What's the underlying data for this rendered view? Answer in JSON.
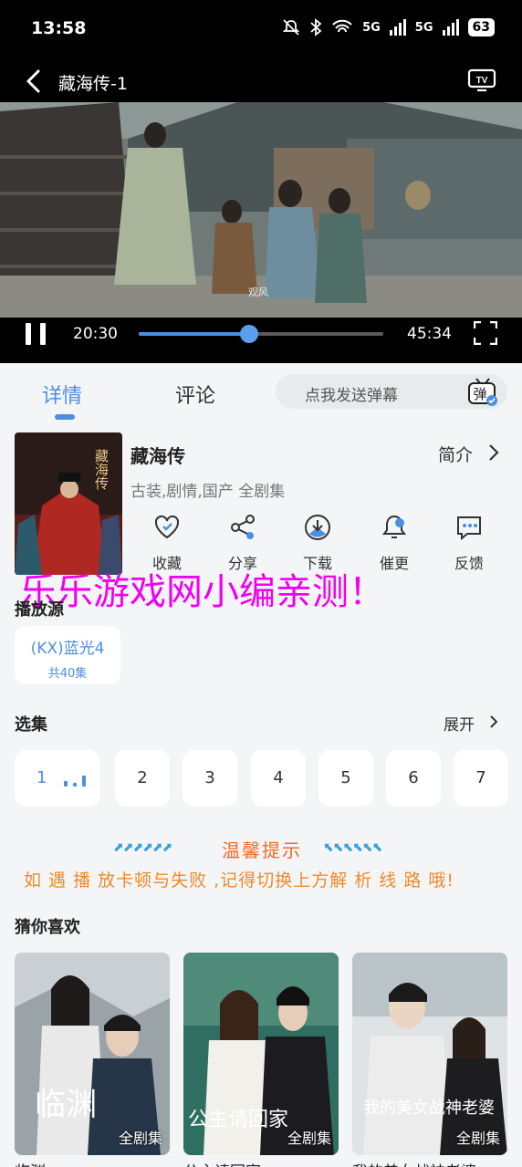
{
  "status_bar": {
    "time": "13:58",
    "signal_1": "5G",
    "signal_2": "5G",
    "battery": "63"
  },
  "nav": {
    "title": "藏海传-1"
  },
  "player": {
    "subtitle": "观风",
    "current_time": "20:30",
    "total_time": "45:34",
    "progress_fraction": 0.45
  },
  "tabs": {
    "detail": "详情",
    "comment": "评论"
  },
  "danmu": {
    "placeholder": "点我发送弹幕",
    "icon_char": "弹"
  },
  "show": {
    "title": "藏海传",
    "intro_label": "简介",
    "tags": "古装,剧情,国产 全剧集",
    "poster_text": "藏海传"
  },
  "actions": [
    {
      "label": "收藏",
      "icon": "heart-icon"
    },
    {
      "label": "分享",
      "icon": "share-icon"
    },
    {
      "label": "下载",
      "icon": "download-icon"
    },
    {
      "label": "催更",
      "icon": "bell-icon"
    },
    {
      "label": "反馈",
      "icon": "feedback-icon"
    }
  ],
  "watermark": "乐乐游戏网小编亲测！",
  "source": {
    "section_title": "播放源",
    "name": "(KX)蓝光4",
    "count": "共40集"
  },
  "episodes": {
    "section_title": "选集",
    "expand_label": "展开",
    "items": [
      "1",
      "2",
      "3",
      "4",
      "5",
      "6",
      "7"
    ]
  },
  "tip": {
    "title": "温馨提示",
    "text": "如 遇 播 放卡顿与失败 ,记得切换上方解 析 线 路 哦!",
    "arrows_left": "⬈⬈⬈⬈⬈⬈",
    "arrows_right": "⬉⬉⬉⬉⬉⬉"
  },
  "recommend": {
    "section_title": "猜你喜欢",
    "items": [
      {
        "title": "临渊",
        "badge": "全剧集",
        "poster_text": "临渊"
      },
      {
        "title": "公主请回家",
        "badge": "全剧集",
        "poster_text": "公主请回家"
      },
      {
        "title": "我的美女战神老婆",
        "badge": "全剧集",
        "poster_text": "我的美女战神老婆"
      }
    ]
  }
}
